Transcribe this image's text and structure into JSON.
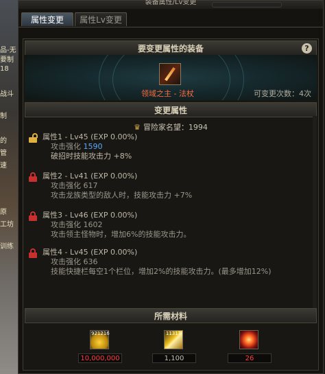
{
  "window": {
    "title": "装备属性/Lv变更"
  },
  "tabs": [
    {
      "label": "属性变更",
      "active": true
    },
    {
      "label": "属性Lv变更",
      "active": false
    }
  ],
  "equipment_section": {
    "header": "要变更属性的装备",
    "help": "?",
    "item_name": "领域之主 - 法杖",
    "remaining_changes": "可变更次数：4次"
  },
  "change_section": {
    "header": "变更属性",
    "fame": "冒险家名望：1994",
    "attributes": [
      {
        "title": "属性1 - Lv45 (EXP 0.00%)",
        "stat_label": "攻击强化",
        "stat_value": "1590",
        "effect": "破招时技能攻击力 +8%",
        "locked": false
      },
      {
        "title": "属性2 - Lv41 (EXP 0.00%)",
        "stat_label": "攻击强化",
        "stat_value": "617",
        "effect": "攻击龙族类型的敌人时，技能攻击力 +7%",
        "locked": true
      },
      {
        "title": "属性3 - Lv46 (EXP 0.00%)",
        "stat_label": "攻击强化",
        "stat_value": "1602",
        "effect": "攻击领主怪物时，增加6%的技能攻击力。",
        "locked": true
      },
      {
        "title": "属性4 - Lv45 (EXP 0.00%)",
        "stat_label": "攻击强化",
        "stat_value": "636",
        "effect": "技能快捷栏每空1个栏位，增加2%的技能攻击力。(最多增加12%)",
        "locked": true
      }
    ]
  },
  "materials_section": {
    "header": "所需材料",
    "items": [
      {
        "name": "gold",
        "badge": "921216",
        "count": "10,000,000",
        "color": "#ff4040"
      },
      {
        "name": "gem",
        "badge": "11313",
        "count": "1,100",
        "color": "#c8c2b2"
      },
      {
        "name": "orb",
        "badge": "",
        "count": "26",
        "color": "#ff4040"
      }
    ]
  },
  "background_fragments": [
    "品-无",
    "要制",
    "18",
    "战斗",
    "制",
    "的",
    "管",
    "速",
    "原",
    "工坊",
    "训练"
  ]
}
